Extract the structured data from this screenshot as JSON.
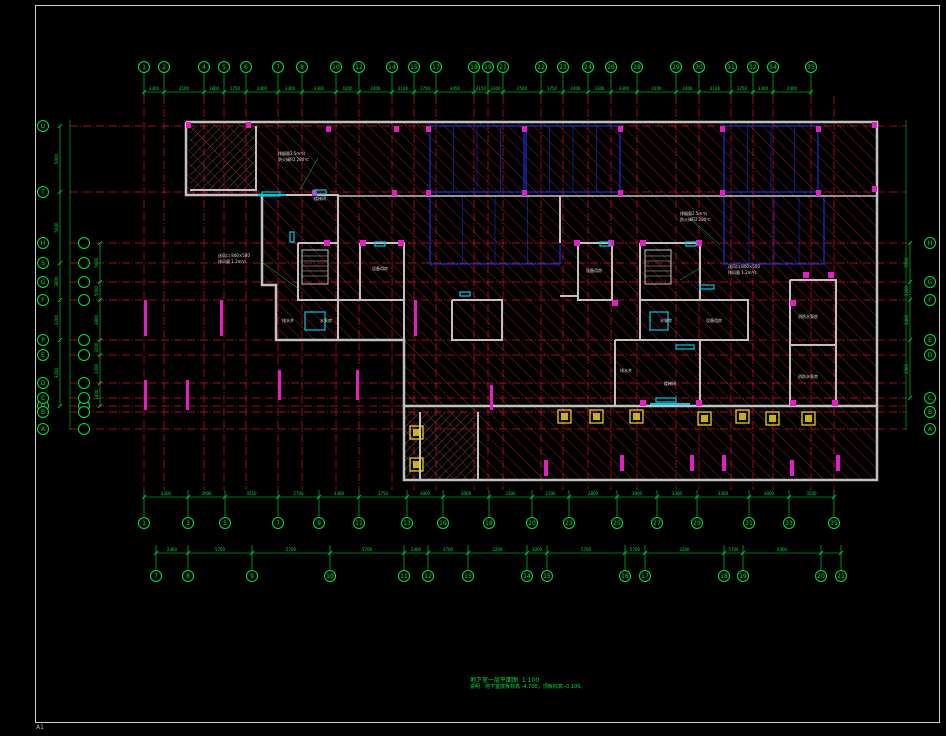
{
  "drawing": {
    "title": "地下室一层平面图",
    "scale": "1:100",
    "note": "说明：地下室底板标高 -4.700，顶板标高 -0.100。",
    "corner_mark": "A1"
  },
  "colors": {
    "background": "#000000",
    "axis": "#00e040",
    "gridline": "#d01020",
    "wall": "#c0c0c0",
    "hatch": "#a02030",
    "slab": "#1830d0",
    "column": "#e020c0",
    "door": "#00c8e0",
    "text": "#e0e0e0",
    "fan": "#f0e020"
  },
  "axes": {
    "top": [
      "1",
      "2",
      "4",
      "5",
      "6",
      "7",
      "8",
      "10",
      "12",
      "14",
      "15",
      "17",
      "18",
      "19",
      "21",
      "22",
      "23",
      "24",
      "26",
      "28",
      "29",
      "30",
      "31",
      "32",
      "34",
      "35"
    ],
    "top_dims": [
      "3300",
      "2100",
      "1800",
      "1750",
      "2400",
      "3300",
      "3300",
      "4200",
      "2400",
      "2100",
      "1750",
      "3450",
      "4150",
      "3300",
      "2500",
      "1750",
      "2400",
      "3300",
      "3300",
      "4200",
      "2400",
      "2100",
      "1750",
      "3300",
      "2400"
    ],
    "bottom1": [
      "1",
      "3",
      "5",
      "7",
      "9",
      "11",
      "13",
      "16",
      "18",
      "20",
      "23",
      "25",
      "27",
      "29",
      "31",
      "33",
      "35"
    ],
    "bottom1_dims": [
      "3300",
      "3900",
      "3550",
      "2700",
      "3300",
      "3750",
      "3900",
      "3000",
      "3300",
      "2100",
      "2800",
      "3900",
      "3300",
      "3300",
      "3900",
      "3500"
    ],
    "bottom2": [
      "7",
      "8",
      "9",
      "10",
      "11",
      "12",
      "13",
      "14",
      "15",
      "16",
      "17",
      "18",
      "19",
      "20",
      "21"
    ],
    "bottom2_dims": [
      "2460",
      "5700",
      "5700",
      "5700",
      "2400",
      "3700",
      "3200",
      "3000",
      "5700",
      "5700",
      "3200",
      "5700",
      "2400"
    ],
    "left": [
      "U",
      "T",
      "H",
      "S",
      "G",
      "F",
      "P",
      "E",
      "D",
      "Q",
      "C",
      "B",
      "A"
    ],
    "left_dims": [
      "5000",
      "5000",
      "3800",
      "3200",
      "3200",
      "1800",
      "1800"
    ],
    "right": [
      "H",
      "G",
      "F",
      "E",
      "D",
      "C",
      "B",
      "A"
    ],
    "right_dims": [
      "3500",
      "3200",
      "3400",
      "1500"
    ]
  },
  "labels": {
    "room_fire": "消防水泵房",
    "room_equip": "设备用房",
    "room_stair": "楼梯间",
    "room_pump": "水泵房",
    "room_well": "排水井",
    "note_a": "排烟量2.5m³/s",
    "note_b": "防火阀FD 280℃",
    "note_c": "送风口 800×500",
    "note_d": "排风量 1.2m³/s"
  }
}
